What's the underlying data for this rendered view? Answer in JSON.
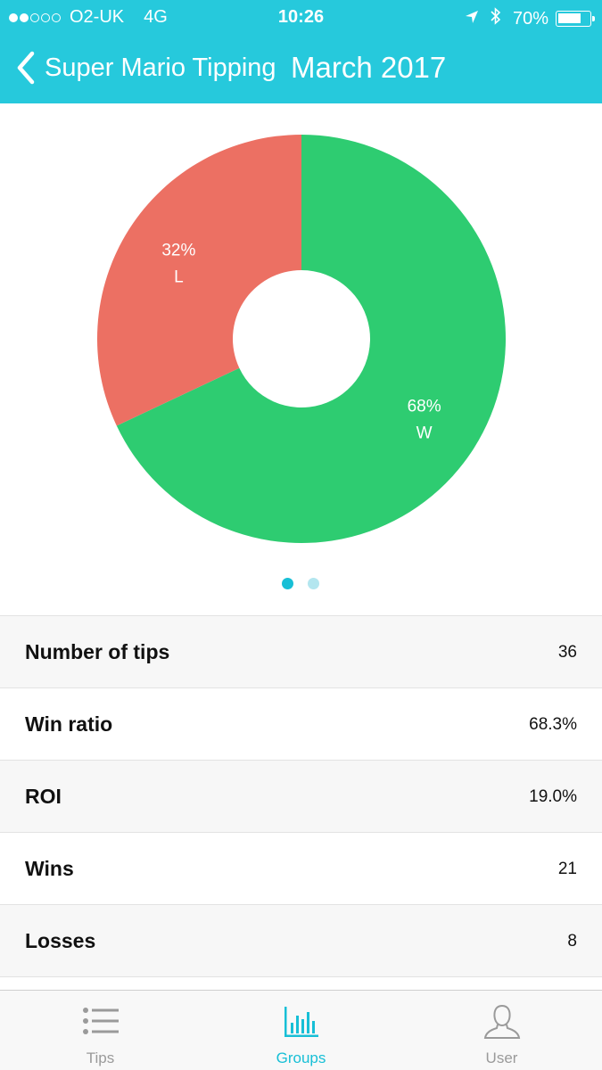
{
  "status_bar": {
    "carrier": "O2-UK",
    "network": "4G",
    "time": "10:26",
    "battery": "70%",
    "battery_level": 0.7,
    "icons": [
      "signal-dots-icon",
      "location-arrow-icon",
      "bluetooth-icon",
      "battery-icon"
    ]
  },
  "header": {
    "group_name": "Super Mario Tipping",
    "period": "March 2017"
  },
  "chart_data": {
    "type": "pie",
    "style": "donut",
    "slices": [
      {
        "label": "W",
        "percent_label": "68%",
        "value": 68,
        "color": "#2ecc71"
      },
      {
        "label": "L",
        "percent_label": "32%",
        "value": 32,
        "color": "#ec7063"
      }
    ]
  },
  "pager": {
    "pages": 2,
    "current": 1
  },
  "stats": [
    {
      "label": "Number of tips",
      "value": "36"
    },
    {
      "label": "Win ratio",
      "value": "68.3%"
    },
    {
      "label": "ROI",
      "value": "19.0%"
    },
    {
      "label": "Wins",
      "value": "21"
    },
    {
      "label": "Losses",
      "value": "8"
    }
  ],
  "tabbar": {
    "tabs": [
      {
        "label": "Tips",
        "icon": "list-icon",
        "active": false
      },
      {
        "label": "Groups",
        "icon": "bar-chart-icon",
        "active": true
      },
      {
        "label": "User",
        "icon": "user-icon",
        "active": false
      }
    ]
  },
  "colors": {
    "header": "#26c9dc",
    "accent": "#17bfd6",
    "win": "#2ecc71",
    "loss": "#ec7063"
  }
}
